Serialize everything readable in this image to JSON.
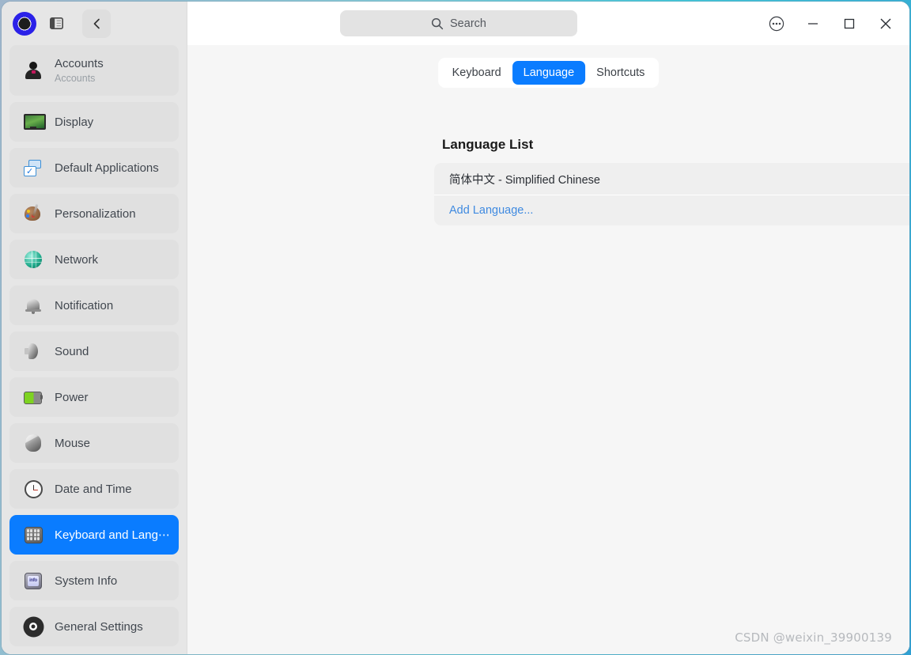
{
  "window": {
    "logo_icon": "deepin-logo-icon",
    "sidebar_toggle_icon": "sidebar-toggle-icon",
    "back_icon": "chevron-left-icon",
    "more_icon": "more-options-icon",
    "minimize_icon": "minimize-icon",
    "maximize_icon": "maximize-icon",
    "close_icon": "close-icon",
    "accent_color": "#0a7cff",
    "border_color": "#35c3d6"
  },
  "search": {
    "icon": "search-icon",
    "placeholder": "Search",
    "value": ""
  },
  "sidebar": {
    "items": [
      {
        "label": "Accounts",
        "sub": "Accounts",
        "icon": "accounts-icon",
        "active": false
      },
      {
        "label": "Display",
        "sub": "",
        "icon": "display-icon",
        "active": false
      },
      {
        "label": "Default Applications",
        "sub": "",
        "icon": "default-applications-icon",
        "active": false
      },
      {
        "label": "Personalization",
        "sub": "",
        "icon": "personalization-icon",
        "active": false
      },
      {
        "label": "Network",
        "sub": "",
        "icon": "network-icon",
        "active": false
      },
      {
        "label": "Notification",
        "sub": "",
        "icon": "notification-icon",
        "active": false
      },
      {
        "label": "Sound",
        "sub": "",
        "icon": "sound-icon",
        "active": false
      },
      {
        "label": "Power",
        "sub": "",
        "icon": "power-icon",
        "active": false
      },
      {
        "label": "Mouse",
        "sub": "",
        "icon": "mouse-icon",
        "active": false
      },
      {
        "label": "Date and Time",
        "sub": "",
        "icon": "clock-icon",
        "active": false
      },
      {
        "label": "Keyboard and Lang⋯",
        "sub": "",
        "icon": "keyboard-icon",
        "active": true
      },
      {
        "label": "System Info",
        "sub": "",
        "icon": "system-info-icon",
        "active": false
      },
      {
        "label": "General Settings",
        "sub": "",
        "icon": "gear-icon",
        "active": false
      }
    ]
  },
  "main": {
    "tabs": [
      {
        "label": "Keyboard",
        "active": false
      },
      {
        "label": "Language",
        "active": true
      },
      {
        "label": "Shortcuts",
        "active": false
      }
    ],
    "section_title": "Language List",
    "languages": [
      {
        "name": "简体中文 - Simplified Chinese",
        "selected": true,
        "check_icon": "check-circle-icon"
      }
    ],
    "add_language_label": "Add Language..."
  },
  "watermark": "CSDN @weixin_39900139"
}
